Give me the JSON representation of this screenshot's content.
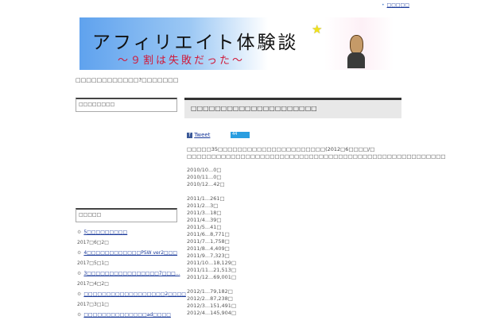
{
  "top_link": "□□□□□",
  "banner": {
    "title": "アフィリエイト体験談",
    "subtitle": "～９割は失敗だった～"
  },
  "tagline": "□□□□□□□□□□□□?□□□□□□□",
  "sidebar": {
    "box1_title": "□□□□□□□□",
    "box2_title": "□□□□□",
    "recent": [
      {
        "title": "5□□□□□□□□□",
        "date": "2017□6□2□"
      },
      {
        "title": "4□□□□□□□□□□□□PSW ver2□□□",
        "date": "2017□5□1□"
      },
      {
        "title": "3□□□□□□□□□□□□□□□□7□□□...",
        "date": "2017□4□2□"
      },
      {
        "title": "□□□□□□□□□□□□□□□□□□2□□□□",
        "date": "2017□3□1□"
      },
      {
        "title": "□□□□□□□□□□□□□□ad□□□□",
        "date": ""
      }
    ]
  },
  "post": {
    "title": "□□□□□□□□□□□□□□□□□□□□□",
    "tweet": "Tweet",
    "fb_icon": "f",
    "count": "44",
    "intro1": "□□□□□35□□□□□□□□□□□□□□□□□□□□□□(2012□6□□□□/□",
    "intro2": "□□□□□□□□□□□□□□□□□□□□□□□□□□□□□□□□□□□□□□□□□□□□□□□□□□□□□"
  },
  "stats": [
    [
      "2010/10...0□",
      "2010/11...0□",
      "2010/12...42□"
    ],
    [
      "2011/1...261□",
      "2011/2...3□",
      "2011/3...18□",
      "2011/4...39□",
      "2011/5...41□",
      "2011/6...8,771□",
      "2011/7...1,758□",
      "2011/8...4,409□",
      "2011/9...7,323□",
      "2011/10...18,129□",
      "2011/11...21,513□",
      "2011/12...69,001□"
    ],
    [
      "2012/1...79,182□",
      "2012/2...87,238□",
      "2012/3...151,491□",
      "2012/4...145,904□"
    ]
  ]
}
